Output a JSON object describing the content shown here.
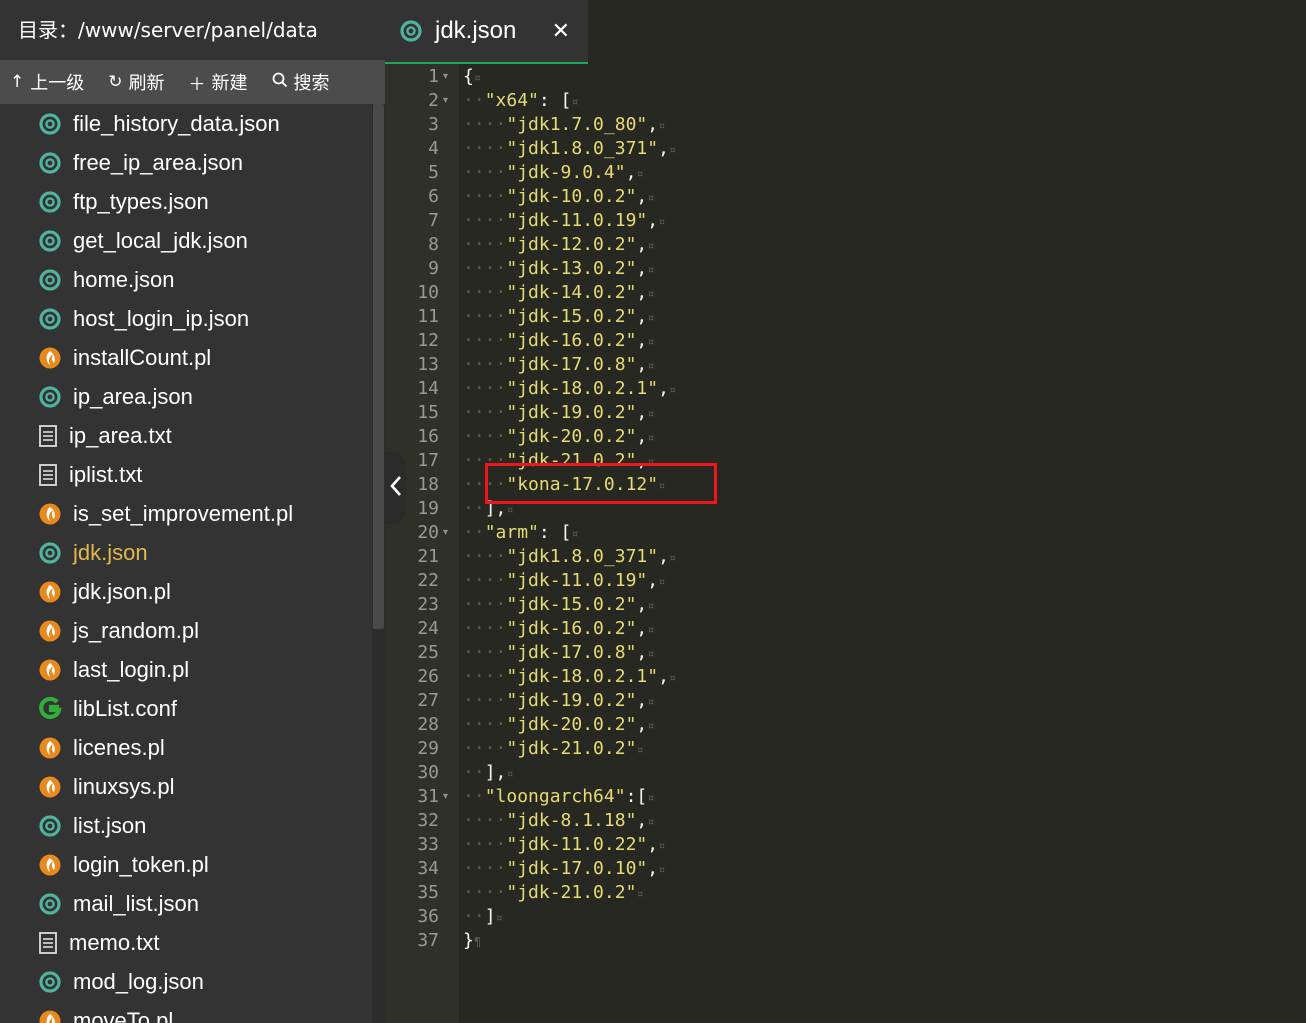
{
  "sidebar": {
    "directory_label": "目录：/www/server/panel/data",
    "toolbar": [
      {
        "icon": "arrow-up-icon",
        "label": "上一级"
      },
      {
        "icon": "refresh-icon",
        "label": "刷新"
      },
      {
        "icon": "plus-icon",
        "label": "新建"
      },
      {
        "icon": "search-icon",
        "label": "搜索"
      }
    ],
    "files": [
      {
        "name": "file_history_data.json",
        "icon": "json-file-icon"
      },
      {
        "name": "free_ip_area.json",
        "icon": "json-file-icon"
      },
      {
        "name": "ftp_types.json",
        "icon": "json-file-icon"
      },
      {
        "name": "get_local_jdk.json",
        "icon": "json-file-icon"
      },
      {
        "name": "home.json",
        "icon": "json-file-icon"
      },
      {
        "name": "host_login_ip.json",
        "icon": "json-file-icon"
      },
      {
        "name": "installCount.pl",
        "icon": "perl-file-icon"
      },
      {
        "name": "ip_area.json",
        "icon": "json-file-icon"
      },
      {
        "name": "ip_area.txt",
        "icon": "text-file-icon"
      },
      {
        "name": "iplist.txt",
        "icon": "text-file-icon"
      },
      {
        "name": "is_set_improvement.pl",
        "icon": "perl-file-icon"
      },
      {
        "name": "jdk.json",
        "icon": "json-file-icon",
        "active": true
      },
      {
        "name": "jdk.json.pl",
        "icon": "perl-file-icon"
      },
      {
        "name": "js_random.pl",
        "icon": "perl-file-icon"
      },
      {
        "name": "last_login.pl",
        "icon": "perl-file-icon"
      },
      {
        "name": "libList.conf",
        "icon": "conf-file-icon"
      },
      {
        "name": "licenes.pl",
        "icon": "perl-file-icon"
      },
      {
        "name": "linuxsys.pl",
        "icon": "perl-file-icon"
      },
      {
        "name": "list.json",
        "icon": "json-file-icon"
      },
      {
        "name": "login_token.pl",
        "icon": "perl-file-icon"
      },
      {
        "name": "mail_list.json",
        "icon": "json-file-icon"
      },
      {
        "name": "memo.txt",
        "icon": "text-file-icon"
      },
      {
        "name": "mod_log.json",
        "icon": "json-file-icon"
      },
      {
        "name": "moveTo.pl",
        "icon": "perl-file-icon"
      }
    ]
  },
  "editor": {
    "tab": {
      "title": "jdk.json",
      "close": "✕"
    },
    "lines": [
      {
        "n": "1",
        "fold": true,
        "indent": 0,
        "text": "{",
        "eol": "¤"
      },
      {
        "n": "2",
        "fold": true,
        "indent": 1,
        "key": "\"x64\"",
        "text": ": [",
        "eol": "¤"
      },
      {
        "n": "3",
        "indent": 2,
        "str": "\"jdk1.7.0_80\"",
        "text": ",",
        "eol": "¤"
      },
      {
        "n": "4",
        "indent": 2,
        "str": "\"jdk1.8.0_371\"",
        "text": ",",
        "eol": "¤"
      },
      {
        "n": "5",
        "indent": 2,
        "str": "\"jdk-9.0.4\"",
        "text": ",",
        "eol": "¤"
      },
      {
        "n": "6",
        "indent": 2,
        "str": "\"jdk-10.0.2\"",
        "text": ",",
        "eol": "¤"
      },
      {
        "n": "7",
        "indent": 2,
        "str": "\"jdk-11.0.19\"",
        "text": ",",
        "eol": "¤"
      },
      {
        "n": "8",
        "indent": 2,
        "str": "\"jdk-12.0.2\"",
        "text": ",",
        "eol": "¤"
      },
      {
        "n": "9",
        "indent": 2,
        "str": "\"jdk-13.0.2\"",
        "text": ",",
        "eol": "¤"
      },
      {
        "n": "10",
        "indent": 2,
        "str": "\"jdk-14.0.2\"",
        "text": ",",
        "eol": "¤"
      },
      {
        "n": "11",
        "indent": 2,
        "str": "\"jdk-15.0.2\"",
        "text": ",",
        "eol": "¤"
      },
      {
        "n": "12",
        "indent": 2,
        "str": "\"jdk-16.0.2\"",
        "text": ",",
        "eol": "¤"
      },
      {
        "n": "13",
        "indent": 2,
        "str": "\"jdk-17.0.8\"",
        "text": ",",
        "eol": "¤"
      },
      {
        "n": "14",
        "indent": 2,
        "str": "\"jdk-18.0.2.1\"",
        "text": ",",
        "eol": "¤"
      },
      {
        "n": "15",
        "indent": 2,
        "str": "\"jdk-19.0.2\"",
        "text": ",",
        "eol": "¤"
      },
      {
        "n": "16",
        "indent": 2,
        "str": "\"jdk-20.0.2\"",
        "text": ",",
        "eol": "¤"
      },
      {
        "n": "17",
        "indent": 2,
        "str": "\"jdk-21.0.2\"",
        "text": ",",
        "eol": "¤"
      },
      {
        "n": "18",
        "indent": 2,
        "str": "\"kona-17.0.12\"",
        "text": "",
        "eol": "¤"
      },
      {
        "n": "19",
        "indent": 1,
        "text": "],",
        "eol": "¤"
      },
      {
        "n": "20",
        "fold": true,
        "indent": 1,
        "key": "\"arm\"",
        "text": ": [",
        "eol": "¤"
      },
      {
        "n": "21",
        "indent": 2,
        "str": "\"jdk1.8.0_371\"",
        "text": ",",
        "eol": "¤"
      },
      {
        "n": "22",
        "indent": 2,
        "str": "\"jdk-11.0.19\"",
        "text": ",",
        "eol": "¤"
      },
      {
        "n": "23",
        "indent": 2,
        "str": "\"jdk-15.0.2\"",
        "text": ",",
        "eol": "¤"
      },
      {
        "n": "24",
        "indent": 2,
        "str": "\"jdk-16.0.2\"",
        "text": ",",
        "eol": "¤"
      },
      {
        "n": "25",
        "indent": 2,
        "str": "\"jdk-17.0.8\"",
        "text": ",",
        "eol": "¤"
      },
      {
        "n": "26",
        "indent": 2,
        "str": "\"jdk-18.0.2.1\"",
        "text": ",",
        "eol": "¤"
      },
      {
        "n": "27",
        "indent": 2,
        "str": "\"jdk-19.0.2\"",
        "text": ",",
        "eol": "¤"
      },
      {
        "n": "28",
        "indent": 2,
        "str": "\"jdk-20.0.2\"",
        "text": ",",
        "eol": "¤"
      },
      {
        "n": "29",
        "indent": 2,
        "str": "\"jdk-21.0.2\"",
        "text": "",
        "eol": "¤"
      },
      {
        "n": "30",
        "indent": 1,
        "text": "],",
        "eol": "¤"
      },
      {
        "n": "31",
        "fold": true,
        "indent": 1,
        "key": "\"loongarch64\"",
        "text": ":[",
        "eol": "¤"
      },
      {
        "n": "32",
        "indent": 2,
        "str": "\"jdk-8.1.18\"",
        "text": ",",
        "eol": "¤"
      },
      {
        "n": "33",
        "indent": 2,
        "str": "\"jdk-11.0.22\"",
        "text": ",",
        "eol": "¤"
      },
      {
        "n": "34",
        "indent": 2,
        "str": "\"jdk-17.0.10\"",
        "text": ",",
        "eol": "¤"
      },
      {
        "n": "35",
        "indent": 2,
        "str": "\"jdk-21.0.2\"",
        "text": "",
        "eol": "¤"
      },
      {
        "n": "36",
        "indent": 1,
        "text": "]",
        "eol": "¤"
      },
      {
        "n": "37",
        "indent": 0,
        "text": "}",
        "eol": "¶"
      }
    ]
  },
  "colors": {
    "sidebar_bg": "#333333",
    "toolbar_bg": "#4c4c4c",
    "editor_bg": "#272822",
    "string": "#e6db74",
    "active_file": "#e0b94a",
    "tab_underline": "#1ea85e",
    "highlight_box": "#f0161e"
  }
}
